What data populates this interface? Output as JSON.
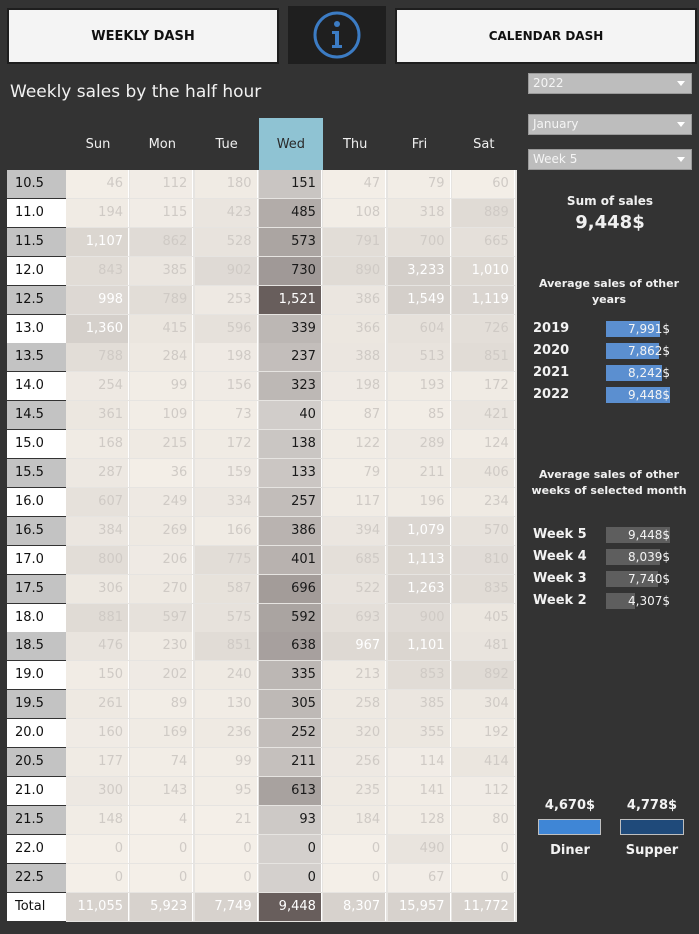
{
  "buttons": {
    "weekly": "WEEKLY DASH",
    "calendar": "CALENDAR DASH"
  },
  "info_icon": "info-circle-icon",
  "title": "Weekly sales by the half hour",
  "filters": {
    "year": "2022",
    "month": "January",
    "week": "Week 5"
  },
  "days": [
    "Sun",
    "Mon",
    "Tue",
    "Wed",
    "Thu",
    "Fri",
    "Sat"
  ],
  "selected_day": "Wed",
  "rows": [
    {
      "label": "10.5",
      "values": [
        "46",
        "112",
        "180",
        "151",
        "47",
        "79",
        "60"
      ]
    },
    {
      "label": "11.0",
      "values": [
        "194",
        "115",
        "423",
        "485",
        "108",
        "318",
        "889"
      ]
    },
    {
      "label": "11.5",
      "values": [
        "1,107",
        "862",
        "528",
        "573",
        "791",
        "700",
        "665"
      ]
    },
    {
      "label": "12.0",
      "values": [
        "843",
        "385",
        "902",
        "730",
        "890",
        "3,233",
        "1,010"
      ]
    },
    {
      "label": "12.5",
      "values": [
        "998",
        "789",
        "253",
        "1,521",
        "386",
        "1,549",
        "1,119"
      ]
    },
    {
      "label": "13.0",
      "values": [
        "1,360",
        "415",
        "596",
        "339",
        "366",
        "604",
        "726"
      ]
    },
    {
      "label": "13.5",
      "values": [
        "788",
        "284",
        "198",
        "237",
        "388",
        "513",
        "851"
      ]
    },
    {
      "label": "14.0",
      "values": [
        "254",
        "99",
        "156",
        "323",
        "198",
        "193",
        "172"
      ]
    },
    {
      "label": "14.5",
      "values": [
        "361",
        "109",
        "73",
        "40",
        "87",
        "85",
        "421"
      ]
    },
    {
      "label": "15.0",
      "values": [
        "168",
        "215",
        "172",
        "138",
        "122",
        "289",
        "124"
      ]
    },
    {
      "label": "15.5",
      "values": [
        "287",
        "36",
        "159",
        "133",
        "79",
        "211",
        "406"
      ]
    },
    {
      "label": "16.0",
      "values": [
        "607",
        "249",
        "334",
        "257",
        "117",
        "196",
        "234"
      ]
    },
    {
      "label": "16.5",
      "values": [
        "384",
        "269",
        "166",
        "386",
        "394",
        "1,079",
        "570"
      ]
    },
    {
      "label": "17.0",
      "values": [
        "800",
        "206",
        "775",
        "401",
        "685",
        "1,113",
        "810"
      ]
    },
    {
      "label": "17.5",
      "values": [
        "306",
        "270",
        "587",
        "696",
        "522",
        "1,263",
        "835"
      ]
    },
    {
      "label": "18.0",
      "values": [
        "881",
        "597",
        "575",
        "592",
        "693",
        "900",
        "405"
      ]
    },
    {
      "label": "18.5",
      "values": [
        "476",
        "230",
        "851",
        "638",
        "967",
        "1,101",
        "481"
      ]
    },
    {
      "label": "19.0",
      "values": [
        "150",
        "202",
        "240",
        "335",
        "213",
        "853",
        "892"
      ]
    },
    {
      "label": "19.5",
      "values": [
        "261",
        "89",
        "130",
        "305",
        "258",
        "385",
        "304"
      ]
    },
    {
      "label": "20.0",
      "values": [
        "160",
        "169",
        "236",
        "252",
        "320",
        "355",
        "192"
      ]
    },
    {
      "label": "20.5",
      "values": [
        "177",
        "74",
        "99",
        "211",
        "256",
        "114",
        "414"
      ]
    },
    {
      "label": "21.0",
      "values": [
        "300",
        "143",
        "95",
        "613",
        "235",
        "141",
        "112"
      ]
    },
    {
      "label": "21.5",
      "values": [
        "148",
        "4",
        "21",
        "93",
        "184",
        "128",
        "80"
      ]
    },
    {
      "label": "22.0",
      "values": [
        "0",
        "0",
        "0",
        "0",
        "0",
        "490",
        "0"
      ]
    },
    {
      "label": "22.5",
      "values": [
        "0",
        "0",
        "0",
        "0",
        "0",
        "67",
        "0"
      ]
    },
    {
      "label": "Total",
      "values": [
        "11,055",
        "5,923",
        "7,749",
        "9,448",
        "8,307",
        "15,957",
        "11,772"
      ]
    }
  ],
  "sum": {
    "label": "Sum of sales",
    "value": "9,448$"
  },
  "years": {
    "title": "Average sales of other years",
    "items": [
      {
        "label": "2019",
        "value": "7,991$",
        "amount": 7991
      },
      {
        "label": "2020",
        "value": "7,862$",
        "amount": 7862
      },
      {
        "label": "2021",
        "value": "8,242$",
        "amount": 8242
      },
      {
        "label": "2022",
        "value": "9,448$",
        "amount": 9448
      }
    ],
    "color": "#5b8fd0"
  },
  "weeks": {
    "title": "Average sales of  other weeks of selected month",
    "items": [
      {
        "label": "Week 5",
        "value": "9,448$",
        "amount": 9448
      },
      {
        "label": "Week 4",
        "value": "8,039$",
        "amount": 8039
      },
      {
        "label": "Week 3",
        "value": "7,740$",
        "amount": 7740
      },
      {
        "label": "Week 2",
        "value": "4,307$",
        "amount": 4307
      }
    ],
    "color": "#5e5e5e"
  },
  "meals": [
    {
      "label": "Diner",
      "value": "4,670$",
      "amount": 4670,
      "color": "#3f86d6"
    },
    {
      "label": "Supper",
      "value": "4,778$",
      "amount": 4778,
      "color": "#1f4a7a"
    }
  ]
}
